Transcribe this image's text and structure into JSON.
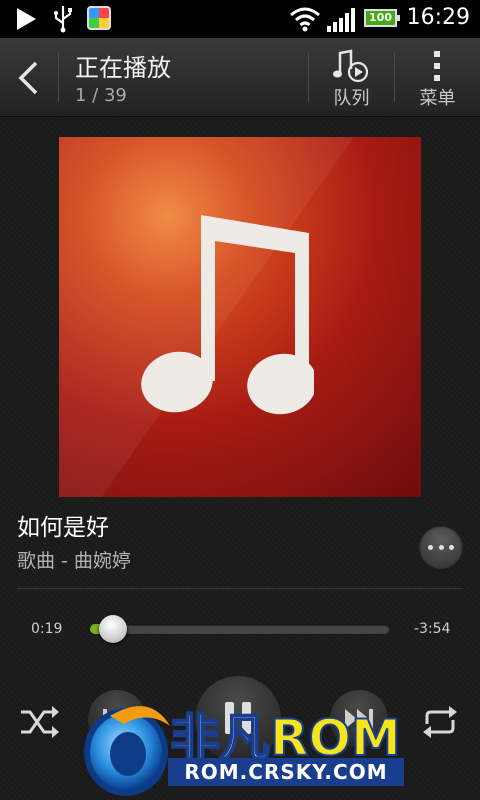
{
  "status_bar": {
    "time": "16:29",
    "battery_level": "100",
    "icons": [
      "play-icon",
      "usb-icon",
      "app-notification-icon",
      "wifi-icon",
      "signal-icon",
      "battery-icon"
    ]
  },
  "header": {
    "title": "正在播放",
    "subtitle": "1 / 39",
    "queue_label": "队列",
    "menu_label": "菜单"
  },
  "track": {
    "title": "如何是好",
    "subtitle": "歌曲 - 曲婉婷"
  },
  "progress": {
    "elapsed": "0:19",
    "remaining": "-3:54",
    "fraction": 0.075
  },
  "controls": [
    "shuffle-icon",
    "previous-icon",
    "pause-icon",
    "next-icon",
    "repeat-icon"
  ],
  "watermark": {
    "name_cn": "非凡",
    "name_en": "ROM",
    "url": "ROM.CRSKY.COM"
  },
  "colors": {
    "accent": "#7ab21e",
    "album_red": "#a81b14",
    "background": "#1a1a1a"
  }
}
